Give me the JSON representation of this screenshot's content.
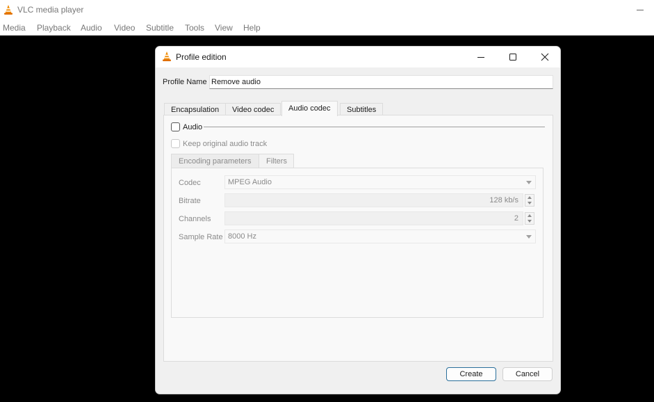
{
  "app": {
    "title": "VLC media player",
    "icon": "vlc-cone-icon",
    "menu": [
      "Media",
      "Playback",
      "Audio",
      "Video",
      "Subtitle",
      "Tools",
      "View",
      "Help"
    ]
  },
  "dialog": {
    "title": "Profile edition",
    "icon": "vlc-cone-icon",
    "controls": [
      "minimize-icon",
      "maximize-icon",
      "close-icon"
    ],
    "profile_name_label": "Profile Name",
    "profile_name_value": "Remove audio",
    "tabs": [
      "Encapsulation",
      "Video codec",
      "Audio codec",
      "Subtitles"
    ],
    "active_tab": "Audio codec",
    "audio_section": {
      "audio_checkbox_label": "Audio",
      "audio_checked": false,
      "keep_original_label": "Keep original audio track",
      "keep_original_checked": false,
      "subtabs": [
        "Encoding parameters",
        "Filters"
      ],
      "active_subtab": "Encoding parameters",
      "fields": {
        "codec_label": "Codec",
        "codec_value": "MPEG Audio",
        "bitrate_label": "Bitrate",
        "bitrate_value": "128 kb/s",
        "channels_label": "Channels",
        "channels_value": "2",
        "sample_rate_label": "Sample Rate",
        "sample_rate_value": "8000 Hz"
      }
    },
    "buttons": {
      "create": "Create",
      "cancel": "Cancel"
    }
  },
  "colors": {
    "vlc_orange": "#f08a00",
    "default_button_border": "#2a6f9b"
  }
}
